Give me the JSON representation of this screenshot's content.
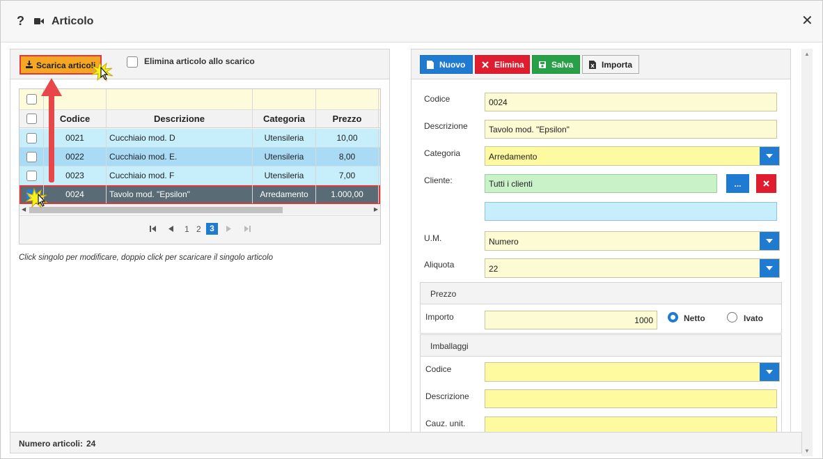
{
  "window": {
    "title": "Articolo",
    "help_icon": "?",
    "close_icon": "✕"
  },
  "left": {
    "download_button": "Scarica articoli",
    "delete_on_download_label": "Elimina articolo allo scarico",
    "grid": {
      "columns": [
        "Codice",
        "Descrizione",
        "Categoria",
        "Prezzo"
      ],
      "rows": [
        {
          "codice": "0021",
          "descrizione": "Cucchiaio mod. D",
          "categoria": "Utensileria",
          "prezzo": "10,00"
        },
        {
          "codice": "0022",
          "descrizione": "Cucchiaio mod. E.",
          "categoria": "Utensileria",
          "prezzo": "8,00"
        },
        {
          "codice": "0023",
          "descrizione": "Cucchiaio mod. F",
          "categoria": "Utensileria",
          "prezzo": "7,00"
        },
        {
          "codice": "0024",
          "descrizione": "Tavolo mod. \"Epsilon\"",
          "categoria": "Arredamento",
          "prezzo": "1.000,00"
        }
      ],
      "pages": [
        "1",
        "2",
        "3"
      ],
      "current_page": "3"
    },
    "hint": "Click singolo per modificare, doppio click per scaricare il singolo articolo"
  },
  "right": {
    "toolbar": {
      "nuovo": "Nuovo",
      "elimina": "Elimina",
      "salva": "Salva",
      "importa": "Importa"
    },
    "form": {
      "codice_label": "Codice",
      "codice_value": "0024",
      "descrizione_label": "Descrizione",
      "descrizione_value": "Tavolo mod. \"Epsilon\"",
      "categoria_label": "Categoria",
      "categoria_value": "Arredamento",
      "cliente_label": "Cliente:",
      "cliente_value": "Tutti i clienti",
      "cliente_browse": "...",
      "um_label": "U.M.",
      "um_value": "Numero",
      "aliquota_label": "Aliquota",
      "aliquota_value": "22"
    },
    "prezzo": {
      "title": "Prezzo",
      "importo_label": "Importo",
      "importo_value": "1000",
      "netto_label": "Netto",
      "ivato_label": "Ivato"
    },
    "imballaggi": {
      "title": "Imballaggi",
      "codice_label": "Codice",
      "descrizione_label": "Descrizione",
      "cauz_label": "Cauz. unit."
    }
  },
  "footer": {
    "label": "Numero articoli:",
    "value": "24"
  },
  "colors": {
    "accent": "#1f7ad1",
    "danger": "#df1d2f",
    "success": "#27a047",
    "highlight": "#f5a623"
  }
}
